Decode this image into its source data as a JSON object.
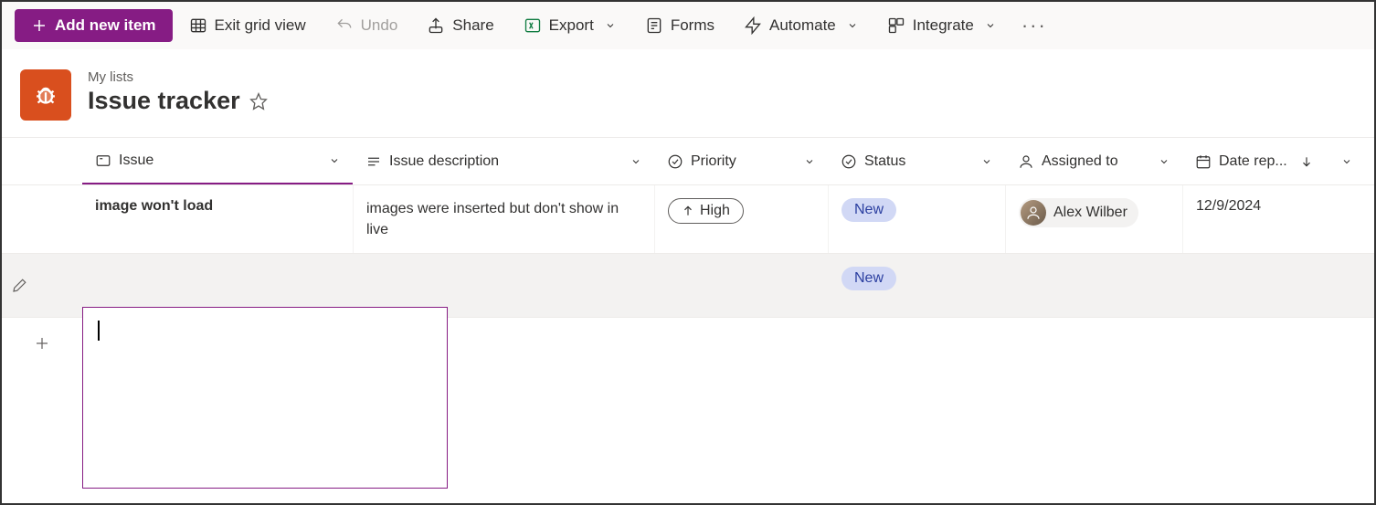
{
  "toolbar": {
    "add_label": "Add new item",
    "exit_grid_label": "Exit grid view",
    "undo_label": "Undo",
    "share_label": "Share",
    "export_label": "Export",
    "forms_label": "Forms",
    "automate_label": "Automate",
    "integrate_label": "Integrate"
  },
  "header": {
    "breadcrumb": "My lists",
    "title": "Issue tracker"
  },
  "columns": {
    "issue": "Issue",
    "description": "Issue description",
    "priority": "Priority",
    "status": "Status",
    "assigned": "Assigned to",
    "date": "Date rep..."
  },
  "rows": [
    {
      "issue": "image won't load",
      "description": "images were inserted but don't show in live",
      "priority": "High",
      "status": "New",
      "assigned": "Alex Wilber",
      "date": "12/9/2024"
    },
    {
      "issue": "",
      "description": "",
      "priority": "",
      "status": "New",
      "assigned": "",
      "date": ""
    }
  ]
}
